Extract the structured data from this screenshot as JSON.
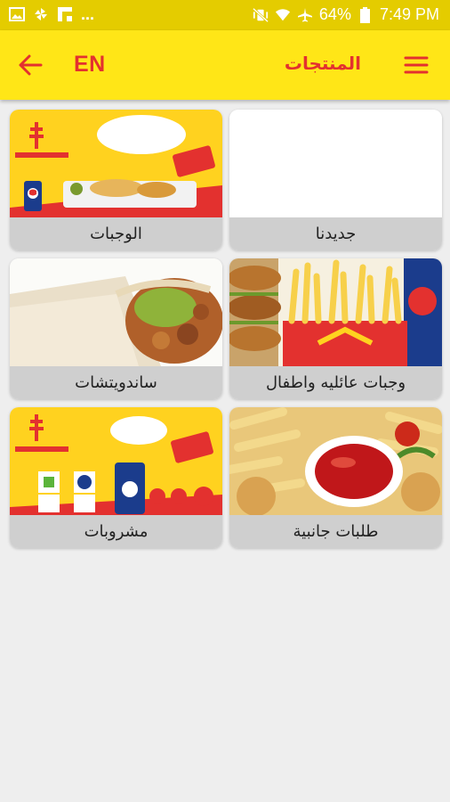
{
  "status_bar": {
    "battery": "64%",
    "time": "7:49 PM",
    "icons": [
      "image-icon",
      "pinwheel-icon",
      "flipboard-icon",
      "more-dots-icon",
      "vibrate-off-icon",
      "wifi-icon",
      "airplane-icon",
      "battery-icon"
    ]
  },
  "app_bar": {
    "language": "EN",
    "title": "المنتجات"
  },
  "categories": [
    {
      "label": "جديدنا"
    },
    {
      "label": "الوجبات"
    },
    {
      "label": "وجبات عائليه واطفال"
    },
    {
      "label": "ساندويتشات"
    },
    {
      "label": "طلبات جانبية"
    },
    {
      "label": "مشروبات"
    }
  ],
  "colors": {
    "status_bar": "#e4cc00",
    "app_bar": "#ffe617",
    "accent": "#e3312f",
    "label_bg": "#cfcfcf"
  }
}
